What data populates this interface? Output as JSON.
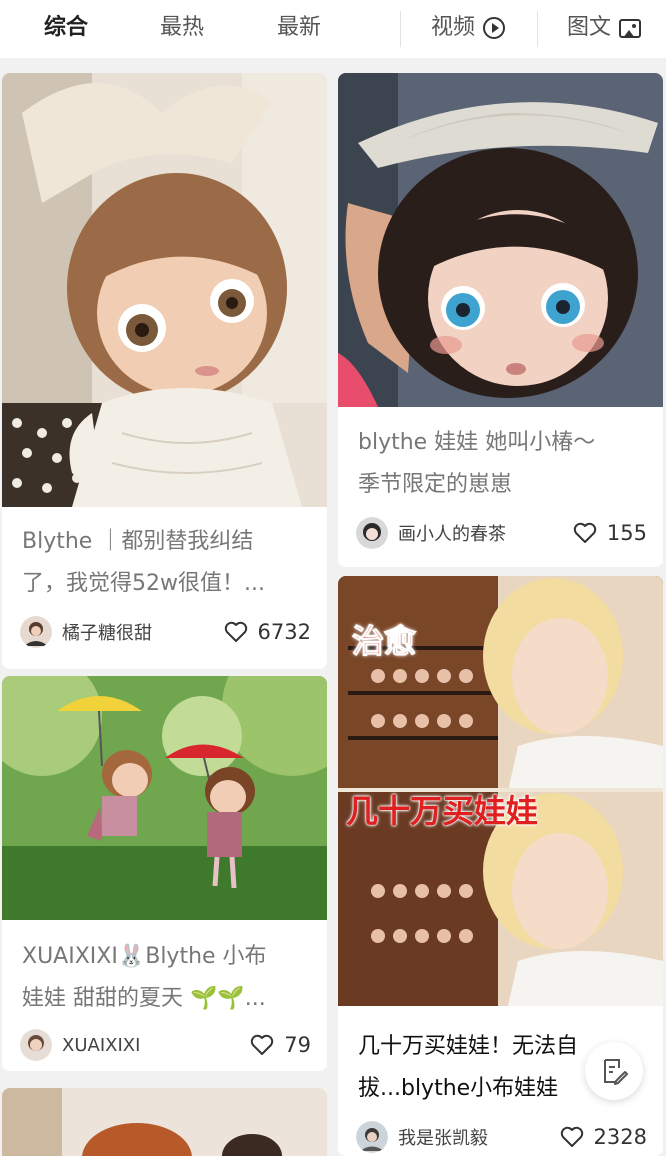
{
  "tabs": {
    "comprehensive": "综合",
    "hottest": "最热",
    "newest": "最新",
    "video": "视频",
    "image_text": "图文"
  },
  "cards": [
    {
      "id": "card1",
      "title": "Blythe ｜都别替我纠结了，我觉得52w很值！...",
      "title_line1": "Blythe ｜都别替我纠结",
      "title_line2": "了，我觉得52w很值！...",
      "author": "橘子糖很甜",
      "likes": "6732"
    },
    {
      "id": "card2",
      "title_line1": "blythe 娃娃 她叫小椿～",
      "title_line2": "季节限定的崽崽",
      "author": "画小人的春茶",
      "likes": "155"
    },
    {
      "id": "card3",
      "title_line1": "XUAIXIXI🐰Blythe 小布",
      "title_line2": "娃娃 甜甜的夏天 🌱🌱...",
      "author": "XUAIXIXI",
      "likes": "79"
    },
    {
      "id": "card4",
      "overlay_top": "治愈",
      "overlay_mid": "几十万买娃娃",
      "title_line1": "几十万买娃娃！无法自",
      "title_line2": "拔...blythe小布娃娃",
      "author": "我是张凯毅",
      "likes": "2328"
    }
  ],
  "icons": {
    "video": "play-circle-icon",
    "image": "image-icon",
    "like": "heart-icon",
    "compose": "edit-note-icon"
  },
  "colors": {
    "background": "#f1f1f1",
    "card": "#ffffff",
    "overlay_red": "#e02020"
  }
}
